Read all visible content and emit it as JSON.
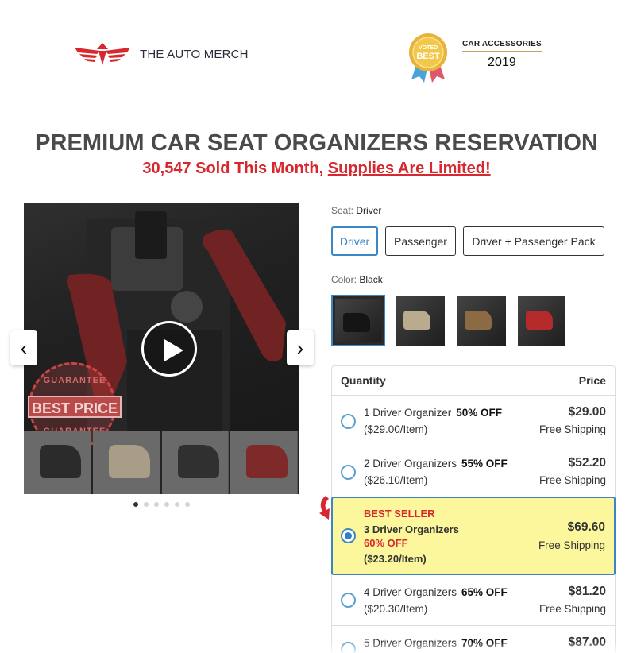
{
  "header": {
    "brand": "THE AUTO MERCH",
    "award_badge_top": "VOTED",
    "award_badge_main": "BEST",
    "award_category": "CAR ACCESSORIES",
    "award_year": "2019"
  },
  "headline": "PREMIUM CAR SEAT ORGANIZERS RESERVATION",
  "subline": {
    "sold_text": "30,547 Sold This Month, ",
    "limited_text": "Supplies Are Limited!"
  },
  "gallery": {
    "badge_top": "GUARANTEE",
    "badge_main": "BEST PRICE",
    "badge_bottom": "GUARANTEE",
    "prev_icon": "‹",
    "next_icon": "›",
    "dots_count": 6,
    "active_dot": 0
  },
  "seat": {
    "label": "Seat:",
    "value": "Driver",
    "options": [
      "Driver",
      "Passenger",
      "Driver + Passenger Pack"
    ],
    "selected": "Driver"
  },
  "color": {
    "label": "Color:",
    "value": "Black",
    "swatches": [
      "black",
      "beige",
      "brown",
      "red"
    ],
    "selected": "black"
  },
  "quantity_table": {
    "col_quantity": "Quantity",
    "col_price": "Price",
    "rows": [
      {
        "name": "1 Driver Organizer",
        "off": "50% OFF",
        "per_item": "($29.00/Item)",
        "price": "$29.00",
        "shipping": "Free Shipping"
      },
      {
        "name": "2 Driver Organizers",
        "off": "55% OFF",
        "per_item": "($26.10/Item)",
        "price": "$52.20",
        "shipping": "Free Shipping"
      },
      {
        "tag": "BEST SELLER",
        "name": "3 Driver Organizers",
        "off": "60% OFF",
        "per_item": "($23.20/Item)",
        "price": "$69.60",
        "shipping": "Free Shipping",
        "selected": true
      },
      {
        "name": "4 Driver Organizers",
        "off": "65% OFF",
        "per_item": "($20.30/Item)",
        "price": "$81.20",
        "shipping": "Free Shipping"
      },
      {
        "name": "5 Driver Organizers",
        "off": "70% OFF",
        "per_item": "",
        "price": "$87.00",
        "shipping": ""
      }
    ]
  },
  "colors": {
    "accent_blue": "#3b86c5",
    "accent_red": "#d8282f",
    "highlight_yellow": "#fcf79c"
  }
}
